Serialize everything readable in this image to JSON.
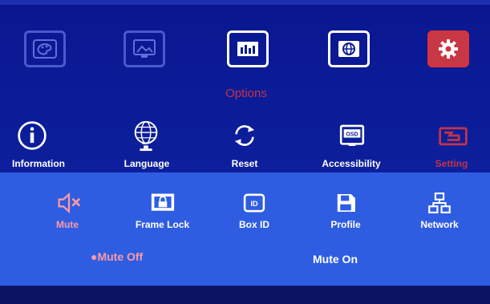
{
  "menu_title": "Options",
  "top_menu": [
    {
      "icon": "palette-icon"
    },
    {
      "icon": "picture-icon"
    },
    {
      "icon": "options-icon"
    },
    {
      "icon": "globe-icon"
    },
    {
      "icon": "gear-icon"
    }
  ],
  "options_items": [
    {
      "label": "Information",
      "icon": "info-icon"
    },
    {
      "label": "Language",
      "icon": "globe-stand-icon"
    },
    {
      "label": "Reset",
      "icon": "reset-icon"
    },
    {
      "label": "Accessibility",
      "icon": "osd-icon"
    },
    {
      "label": "Setting",
      "icon": "settings-icon"
    }
  ],
  "setting_items": [
    {
      "label": "Mute",
      "icon": "speaker-mute-icon"
    },
    {
      "label": "Frame Lock",
      "icon": "frame-lock-icon"
    },
    {
      "label": "Box ID",
      "icon": "id-icon"
    },
    {
      "label": "Profile",
      "icon": "save-icon"
    },
    {
      "label": "Network",
      "icon": "network-icon"
    }
  ],
  "mute_values": {
    "off": "●Mute Off",
    "on": "Mute On"
  },
  "colors": {
    "background": "#0c1a8e",
    "band": "#2f5de2",
    "accent_red": "#c2344a",
    "accent_pink": "#ff9aa4"
  }
}
